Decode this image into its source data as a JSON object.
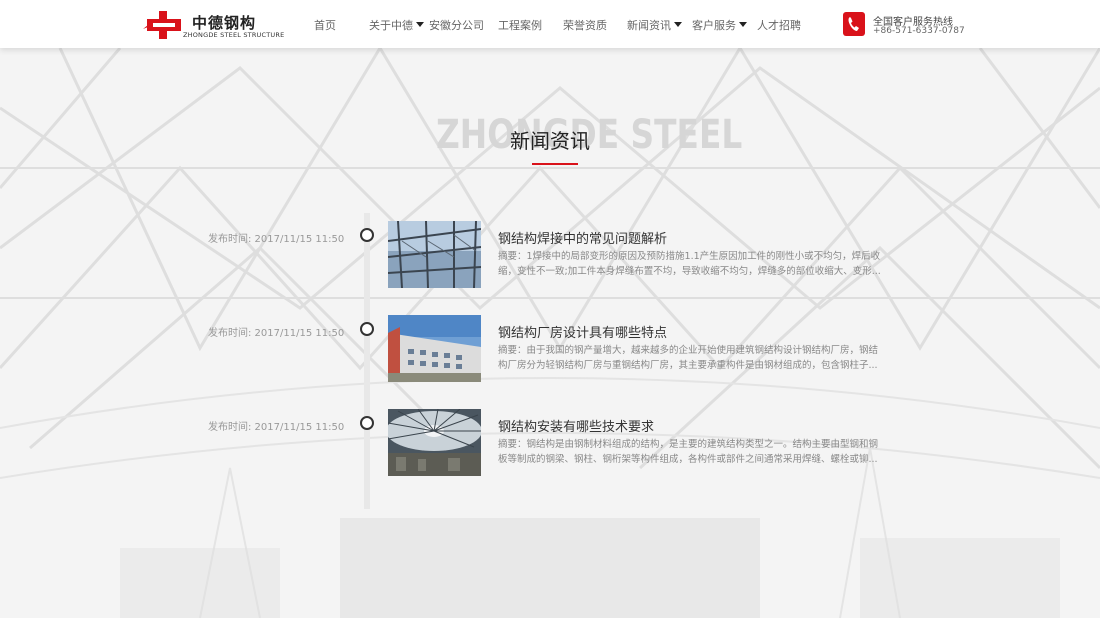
{
  "header": {
    "logo_cn": "中德钢构",
    "logo_en": "ZHONGDE STEEL STRUCTURE",
    "nav": [
      {
        "label": "首页",
        "dropdown": false
      },
      {
        "label": "关于中德",
        "dropdown": true
      },
      {
        "label": "安徽分公司",
        "dropdown": false
      },
      {
        "label": "工程案例",
        "dropdown": false
      },
      {
        "label": "荣誉资质",
        "dropdown": false
      },
      {
        "label": "新闻资讯",
        "dropdown": true
      },
      {
        "label": "客户服务",
        "dropdown": true
      },
      {
        "label": "人才招聘",
        "dropdown": false
      }
    ],
    "hotline_label": "全国客户服务热线",
    "hotline_number": "+86-571-6337-0787"
  },
  "section": {
    "title_bg": "ZHONGDE STEEL",
    "title": "新闻资讯"
  },
  "colors": {
    "accent": "#d9121a"
  },
  "news": [
    {
      "date": "发布时间:  2017/11/15 11:50",
      "title": "钢结构焊接中的常见问题解析",
      "summary": "摘要：1焊接中的局部变形的原因及预防措施1.1产生原因加工件的刚性小或不均匀，焊后收缩，变性不一致;加工件本身焊缝布置不均，导致收缩不均匀，焊缝多的部位收缩大、变形..."
    },
    {
      "date": "发布时间:  2017/11/15 11:50",
      "title": "钢结构厂房设计具有哪些特点",
      "summary": "摘要：由于我国的钢产量增大，越来越多的企业开始使用建筑钢结构设计钢结构厂房，钢结构厂房分为轻钢结构厂房与重钢结构厂房，其主要承重构件是由钢材组成的，包含钢柱子..."
    },
    {
      "date": "发布时间:  2017/11/15 11:50",
      "title": "钢结构安装有哪些技术要求",
      "summary": "摘要：钢结构是由钢制材料组成的结构，是主要的建筑结构类型之一。结构主要由型钢和钢板等制成的钢梁、钢柱、钢桁架等构件组成，各构件或部件之间通常采用焊缝、螺栓或铆..."
    }
  ]
}
